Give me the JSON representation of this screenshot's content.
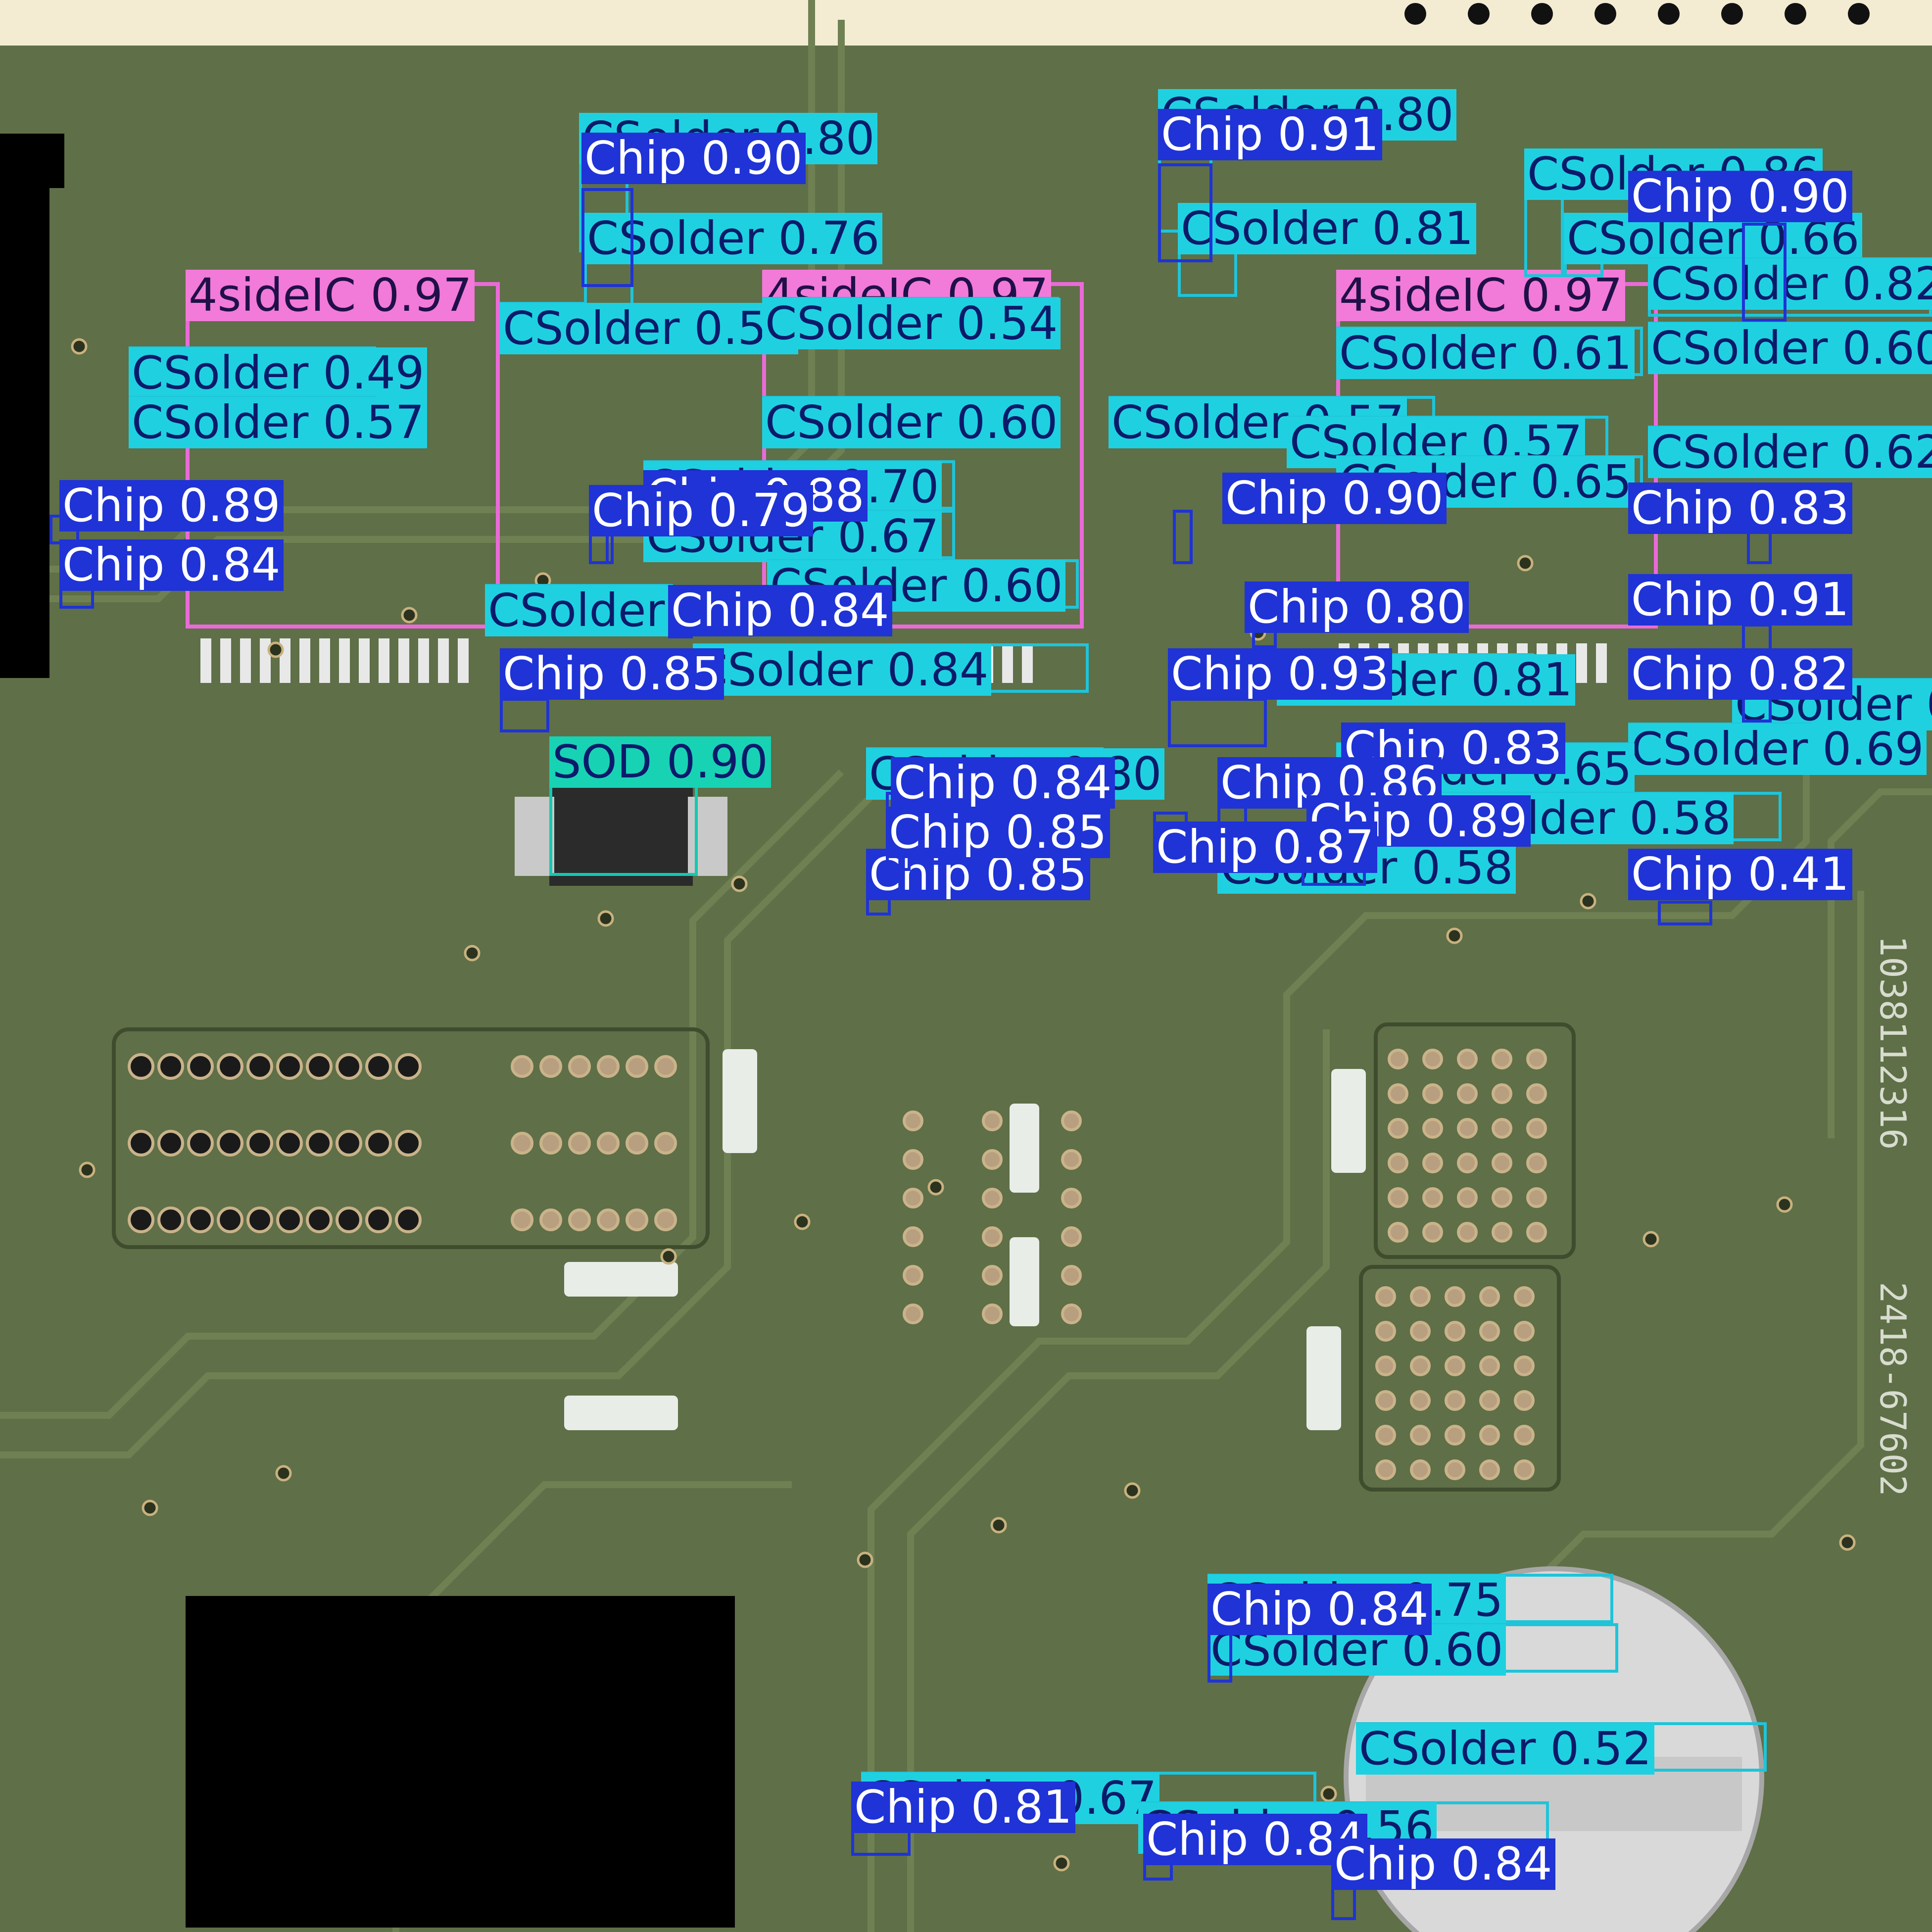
{
  "image": {
    "kind": "PCB detection overlay",
    "board_color": "#5f6f47",
    "margin_color": "#f3ecd2",
    "silkscreen": [
      "1038112316",
      "2418-67602"
    ]
  },
  "classes": {
    "Chip": {
      "box": "#1f33d6",
      "fill": "#1f33d6",
      "text": "#ffffff"
    },
    "CSolder": {
      "box": "#1fc4d9",
      "fill": "#1fd1e0",
      "text": "#0c1a6b"
    },
    "4sideIC": {
      "box": "#ea6ad8",
      "fill": "#f27ad9",
      "text": "#201048"
    },
    "SOD": {
      "box": "#14c9b0",
      "fill": "#18d2b4",
      "text": "#0c1a6b"
    }
  },
  "detections": [
    {
      "cls": "4sideIC",
      "text": "4sideIC 0.97"
    },
    {
      "cls": "4sideIC",
      "text": "4sideIC 0.97"
    },
    {
      "cls": "4sideIC",
      "text": "4sideIC 0.97"
    },
    {
      "cls": "CSolder",
      "text": "CSolder 0.80"
    },
    {
      "cls": "CSolder",
      "text": "CSolder 0.80"
    },
    {
      "cls": "CSolder",
      "text": "CSolder 0.86"
    },
    {
      "cls": "CSolder",
      "text": "CSolder 0.81"
    },
    {
      "cls": "CSolder",
      "text": "CSolder 0.76"
    },
    {
      "cls": "CSolder",
      "text": "CSolder 0.66"
    },
    {
      "cls": "CSolder",
      "text": "CSolder 0.82"
    },
    {
      "cls": "CSolder",
      "text": "CSolder 0.60"
    },
    {
      "cls": "CSolder",
      "text": "CSolder 0.62"
    },
    {
      "cls": "CSolder",
      "text": "CSolder 0.56"
    },
    {
      "cls": "CSolder",
      "text": "CSolder 0.49"
    },
    {
      "cls": "CSolder",
      "text": "CSolder 0.57"
    },
    {
      "cls": "CSolder",
      "text": "CSolder 0.54"
    },
    {
      "cls": "CSolder",
      "text": "CSolder 0.60"
    },
    {
      "cls": "CSolder",
      "text": "CSolder 0.57"
    },
    {
      "cls": "CSolder",
      "text": "CSolder 0.70"
    },
    {
      "cls": "CSolder",
      "text": "CSolder 0.67"
    },
    {
      "cls": "CSolder",
      "text": "CSolder 0.60"
    },
    {
      "cls": "CSolder",
      "text": "CSolder 0.66"
    },
    {
      "cls": "CSolder",
      "text": "CSolder 0.84"
    },
    {
      "cls": "CSolder",
      "text": "CSolder 0.61"
    },
    {
      "cls": "CSolder",
      "text": "CSolder 0.57"
    },
    {
      "cls": "CSolder",
      "text": "CSolder 0.65"
    },
    {
      "cls": "CSolder",
      "text": "CSolder 0.81"
    },
    {
      "cls": "CSolder",
      "text": "CSolder 0.72"
    },
    {
      "cls": "CSolder",
      "text": "CSolder 0.69"
    },
    {
      "cls": "CSolder",
      "text": "CSolder 0.80"
    },
    {
      "cls": "CSolder",
      "text": "CSolder 0.58"
    },
    {
      "cls": "CSolder",
      "text": "CSolder 0.75"
    },
    {
      "cls": "CSolder",
      "text": "CSolder 0.60"
    },
    {
      "cls": "CSolder",
      "text": "CSolder 0.52"
    },
    {
      "cls": "CSolder",
      "text": "CSolder 0.67"
    },
    {
      "cls": "CSolder",
      "text": "CSolder 0.56"
    },
    {
      "cls": "CSolder",
      "text": "CSolder 0.65"
    },
    {
      "cls": "CSolder",
      "text": "CSolder 0.58"
    },
    {
      "cls": "SOD",
      "text": "SOD 0.90"
    },
    {
      "cls": "Chip",
      "text": "Chip 0.90"
    },
    {
      "cls": "Chip",
      "text": "Chip 0.91"
    },
    {
      "cls": "Chip",
      "text": "Chip 0.90"
    },
    {
      "cls": "Chip",
      "text": "Chip 0.89"
    },
    {
      "cls": "Chip",
      "text": "Chip 0.84"
    },
    {
      "cls": "Chip",
      "text": "Chip 0.88"
    },
    {
      "cls": "Chip",
      "text": "Chip 0.79"
    },
    {
      "cls": "Chip",
      "text": "Chip 0.90"
    },
    {
      "cls": "Chip",
      "text": "Chip 0.83"
    },
    {
      "cls": "Chip",
      "text": "Chip 0.84"
    },
    {
      "cls": "Chip",
      "text": "Chip 0.80"
    },
    {
      "cls": "Chip",
      "text": "Chip 0.91"
    },
    {
      "cls": "Chip",
      "text": "Chip 0.85"
    },
    {
      "cls": "Chip",
      "text": "Chip 0.93"
    },
    {
      "cls": "Chip",
      "text": "Chip 0.82"
    },
    {
      "cls": "Chip",
      "text": "Chip 0.83"
    },
    {
      "cls": "Chip",
      "text": "Chip 0.84"
    },
    {
      "cls": "Chip",
      "text": "Chip 0.86"
    },
    {
      "cls": "Chip",
      "text": "Chip 0.89"
    },
    {
      "cls": "Chip",
      "text": "Chip 0.85"
    },
    {
      "cls": "Chip",
      "text": "Chip 0.87"
    },
    {
      "cls": "Chip",
      "text": "Chip 0.85"
    },
    {
      "cls": "Chip",
      "text": "Chip 0.41"
    },
    {
      "cls": "Chip",
      "text": "Chip 0.84"
    },
    {
      "cls": "Chip",
      "text": "Chip 0.81"
    },
    {
      "cls": "Chip",
      "text": "Chip 0.84"
    },
    {
      "cls": "Chip",
      "text": "Chip 0.84"
    }
  ]
}
